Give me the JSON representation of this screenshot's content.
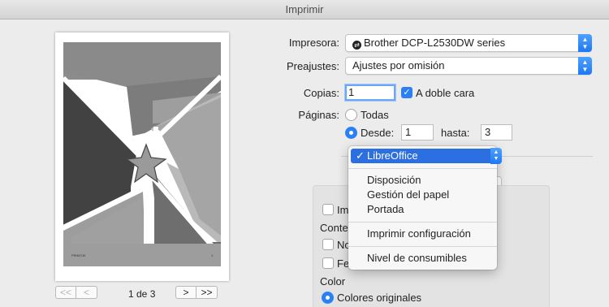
{
  "window": {
    "title": "Imprimir"
  },
  "preview": {
    "page_indicator": "1 de 3",
    "footer_left": "PRINTOK",
    "footer_right": "1",
    "nav": {
      "first": "<<",
      "prev": "<",
      "next": ">",
      "last": ">>"
    }
  },
  "printer": {
    "label": "Impresora:",
    "value": "Brother DCP-L2530DW series"
  },
  "presets": {
    "label": "Preajustes:",
    "value": "Ajustes por omisión"
  },
  "copies": {
    "label": "Copias:",
    "value": "1",
    "duplex_label": "A doble cara",
    "duplex_checked": true
  },
  "pages": {
    "label": "Páginas:",
    "all_label": "Todas",
    "range_label": "Desde:",
    "from": "1",
    "to_label": "hasta:",
    "to": "3",
    "selected": "range"
  },
  "section_menu": {
    "items": [
      {
        "label": "LibreOffice",
        "checked": true
      },
      {
        "label": "Disposición"
      },
      {
        "label": "Gestión del papel"
      },
      {
        "label": "Portada"
      },
      {
        "label": "Imprimir configuración"
      },
      {
        "label": "Nivel de consumibles"
      }
    ],
    "check_glyph": "✓"
  },
  "options": {
    "row1_label": "Imp",
    "contents_label": "Conter",
    "row2_label": "No",
    "row3_label": "Fec",
    "color_label": "Color",
    "original_colors_label": "Colores originales"
  },
  "colors": {
    "accent": "#2b80f5",
    "menu_highlight": "#2b6fe0"
  }
}
